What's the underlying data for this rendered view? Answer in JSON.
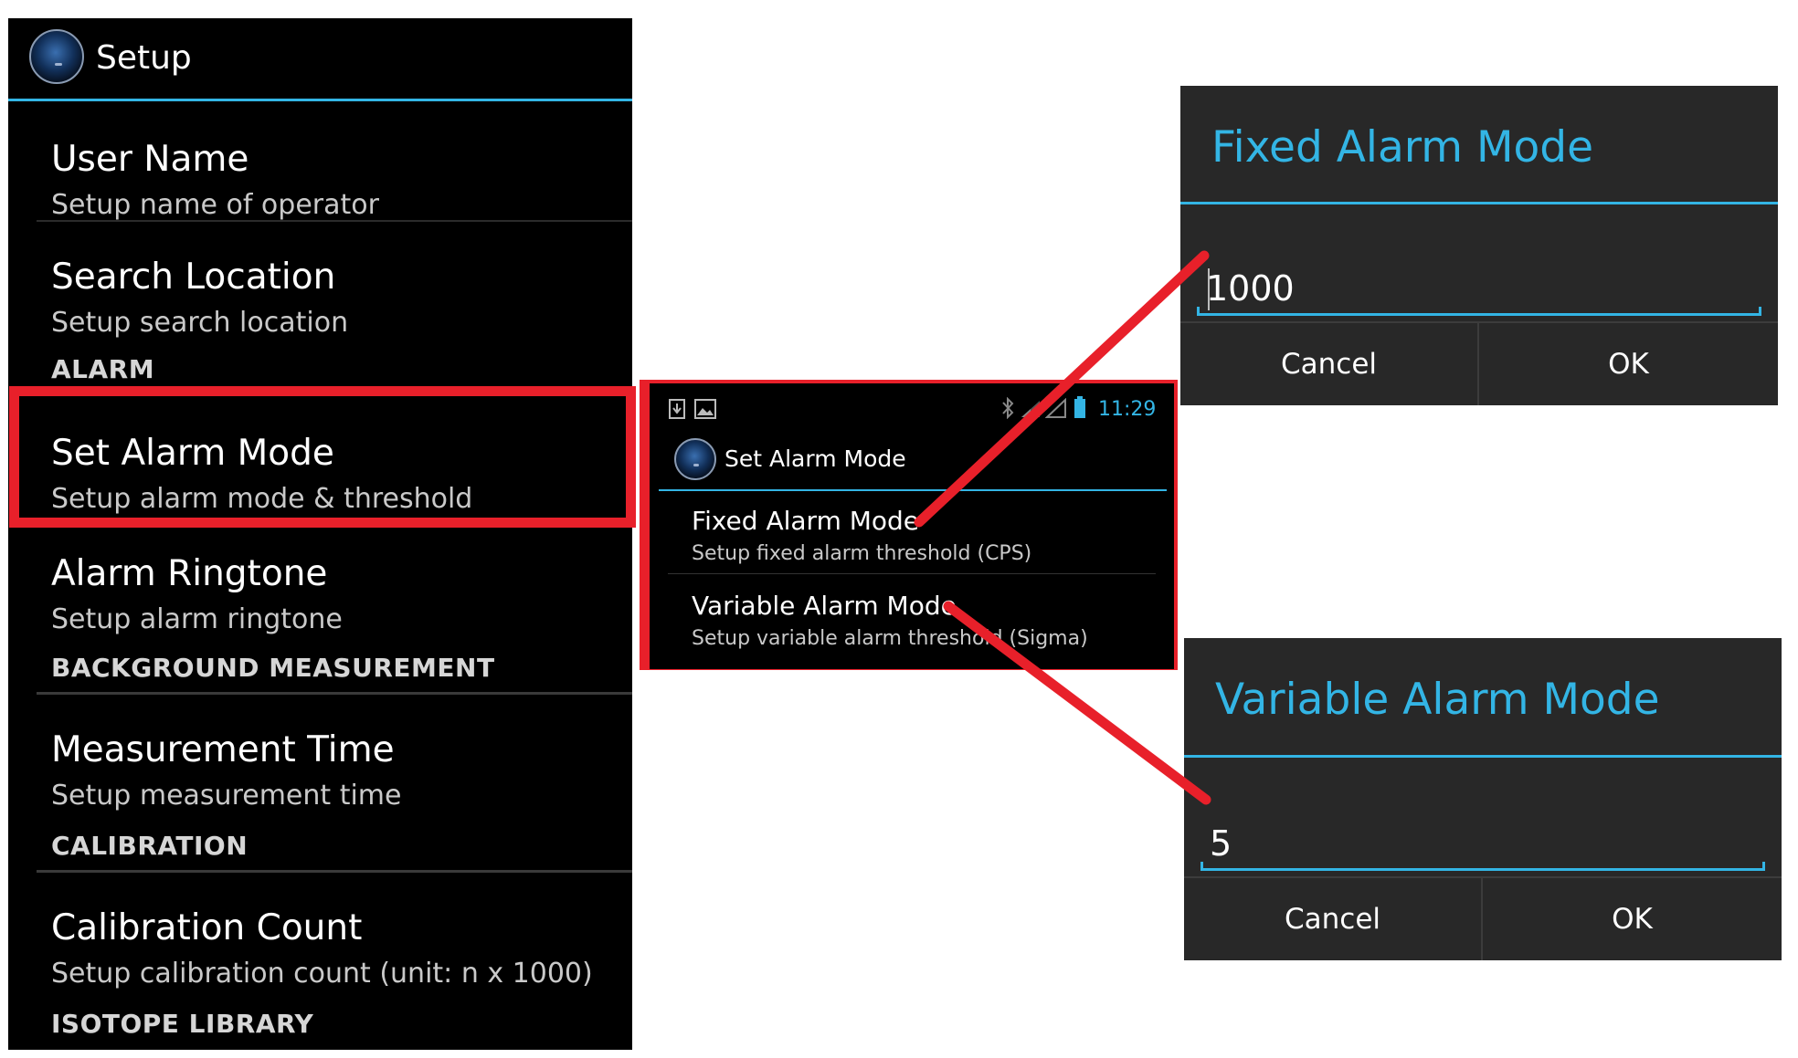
{
  "setup_screen": {
    "title": "Setup",
    "preferences": [
      {
        "title": "User Name",
        "summary": "Setup name of operator"
      },
      {
        "title": "Search Location",
        "summary": "Setup search location"
      },
      {
        "title": "Set Alarm Mode",
        "summary": "Setup alarm mode & threshold"
      },
      {
        "title": "Alarm Ringtone",
        "summary": "Setup alarm ringtone"
      },
      {
        "title": "Measurement Time",
        "summary": "Setup measurement time"
      },
      {
        "title": "Calibration Count",
        "summary": "Setup calibration count (unit: n x 1000)"
      }
    ],
    "categories": [
      "ALARM",
      "BACKGROUND MEASUREMENT",
      "CALIBRATION",
      "ISOTOPE LIBRARY"
    ]
  },
  "alarm_mode_screen": {
    "status_time": "11:29",
    "title": "Set Alarm Mode",
    "items": [
      {
        "title": "Fixed Alarm Mode",
        "summary": "Setup fixed alarm threshold (CPS)"
      },
      {
        "title": "Variable Alarm Mode",
        "summary": "Setup variable alarm threshold (Sigma)"
      }
    ]
  },
  "fixed_dialog": {
    "title": "Fixed Alarm Mode",
    "value": "1000",
    "cancel_label": "Cancel",
    "ok_label": "OK"
  },
  "variable_dialog": {
    "title": "Variable Alarm Mode",
    "value": "5",
    "cancel_label": "Cancel",
    "ok_label": "OK"
  },
  "colors": {
    "accent": "#33b5e5",
    "highlight": "#e8202a",
    "background": "#000000",
    "dialog_bg": "#282828"
  }
}
